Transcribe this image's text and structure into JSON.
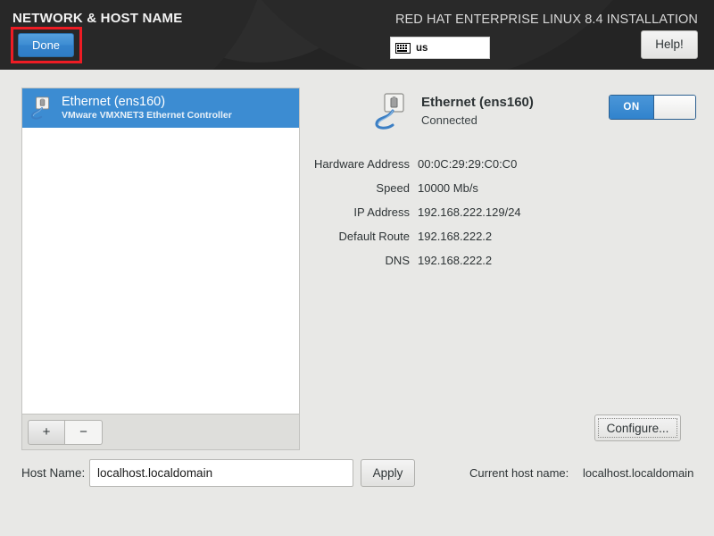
{
  "header": {
    "spoke_title": "NETWORK & HOST NAME",
    "distro_title": "RED HAT ENTERPRISE LINUX 8.4 INSTALLATION",
    "done_label": "Done",
    "help_label": "Help!",
    "keyboard_layout": "us",
    "keyboard_icon": "keyboard-icon",
    "annotation_color": "#ed1c24",
    "accent_color": "#3c8cd2"
  },
  "device_list": {
    "items": [
      {
        "name": "Ethernet (ens160)",
        "description": "VMware VMXNET3 Ethernet Controller",
        "icon": "ethernet-icon",
        "selected": true
      }
    ],
    "toolbar": {
      "add_label": "+",
      "remove_label": "−"
    }
  },
  "detail": {
    "icon": "ethernet-icon",
    "title": "Ethernet (ens160)",
    "status": "Connected",
    "toggle": {
      "on_label": "ON",
      "state": "ON"
    },
    "rows": [
      {
        "label": "Hardware Address",
        "value": "00:0C:29:29:C0:C0"
      },
      {
        "label": "Speed",
        "value": "10000 Mb/s"
      },
      {
        "label": "IP Address",
        "value": "192.168.222.129/24"
      },
      {
        "label": "Default Route",
        "value": "192.168.222.2"
      },
      {
        "label": "DNS",
        "value": "192.168.222.2"
      }
    ],
    "configure_label": "Configure..."
  },
  "hostname": {
    "label": "Host Name:",
    "value": "localhost.localdomain",
    "placeholder": "localhost.localdomain",
    "apply_label": "Apply",
    "current_label": "Current host name:",
    "current_value": "localhost.localdomain"
  }
}
